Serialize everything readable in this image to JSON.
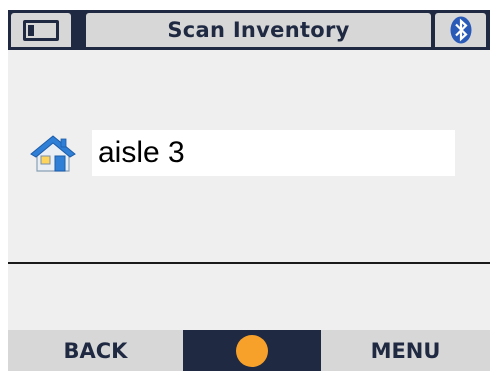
{
  "header": {
    "title": "Scan Inventory",
    "battery_icon": "battery-icon",
    "bluetooth_icon": "bluetooth-icon"
  },
  "location": {
    "icon": "home-icon",
    "value": "aisle 3"
  },
  "softkeys": {
    "left_label": "BACK",
    "center_icon": "orange-dot-icon",
    "right_label": "MENU"
  },
  "colors": {
    "header_bg": "#1f2a42",
    "tab_bg": "#d7d7d7",
    "screen_bg": "#efefef",
    "accent_orange": "#f7a12b",
    "bluetooth_blue": "#2a5ab8"
  }
}
